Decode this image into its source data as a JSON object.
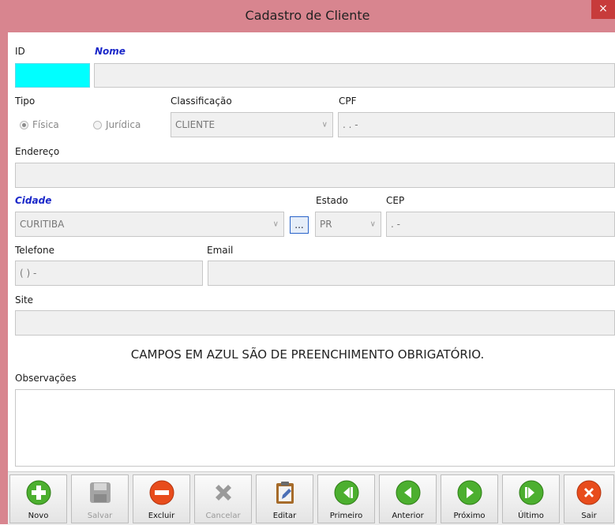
{
  "window": {
    "title": "Cadastro de Cliente",
    "close_glyph": "×"
  },
  "labels": {
    "id": "ID",
    "nome": "Nome",
    "tipo": "Tipo",
    "classificacao": "Classificação",
    "cpf": "CPF",
    "endereco": "Endereço",
    "cidade": "Cidade",
    "estado": "Estado",
    "cep": "CEP",
    "telefone": "Telefone",
    "email": "Email",
    "site": "Site",
    "observacoes": "Observações"
  },
  "tipo_options": [
    {
      "label": "Física",
      "selected": true
    },
    {
      "label": "Jurídica",
      "selected": false
    }
  ],
  "values": {
    "id": "",
    "nome": "",
    "classificacao": "CLIENTE",
    "cpf": " .  .  -",
    "endereco": "",
    "cidade": "CURITIBA",
    "estado": "PR",
    "cep": " .  -",
    "telefone": "(  )   -",
    "email": "",
    "site": "",
    "observacoes": ""
  },
  "lookup_button": "...",
  "notice": "CAMPOS EM AZUL SÃO DE PREENCHIMENTO OBRIGATÓRIO.",
  "toolbar": {
    "novo": "Novo",
    "salvar": "Salvar",
    "excluir": "Excluir",
    "cancelar": "Cancelar",
    "editar": "Editar",
    "primeiro": "Primeiro",
    "anterior": "Anterior",
    "proximo": "Próximo",
    "ultimo": "Último",
    "sair": "Sair"
  },
  "colors": {
    "title_bar": "#d8858f",
    "required_label": "#1a27c9",
    "id_field": "#00ffff",
    "green_icon": "#4caf2f",
    "red_icon": "#e84c1c",
    "disabled_icon": "#9a9a9a"
  }
}
